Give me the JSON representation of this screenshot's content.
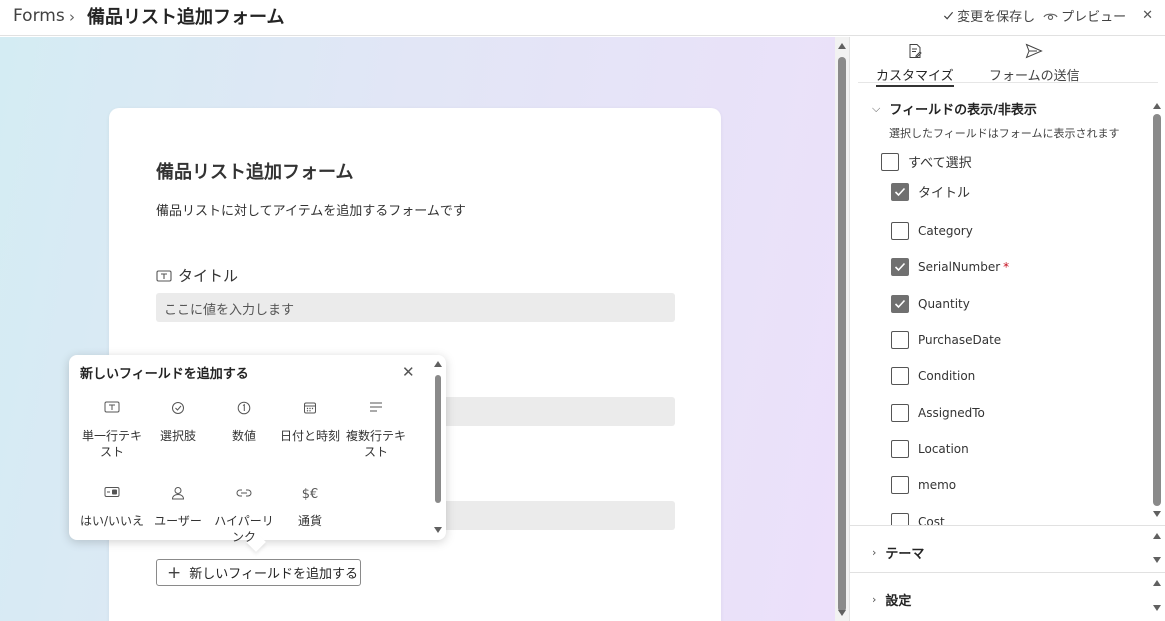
{
  "header": {
    "app_name": "Forms",
    "separator": "›",
    "form_title": "備品リスト追加フォーム",
    "save_label": "変更を保存し",
    "preview_label": "プレビュー",
    "close_glyph": "✕"
  },
  "form": {
    "title": "備品リスト追加フォーム",
    "description": "備品リストに対してアイテムを追加するフォームです",
    "fields": [
      {
        "label": "タイトル",
        "placeholder": "ここに値を入力します"
      }
    ],
    "add_field_button": "新しいフィールドを追加する"
  },
  "popup": {
    "title": "新しいフィールドを追加する",
    "close_glyph": "✕",
    "field_types": [
      {
        "label": "単一行テキスト",
        "icon": "single-line-text-icon"
      },
      {
        "label": "選択肢",
        "icon": "choice-icon"
      },
      {
        "label": "数値",
        "icon": "number-icon"
      },
      {
        "label": "日付と時刻",
        "icon": "calendar-icon"
      },
      {
        "label": "複数行テキスト",
        "icon": "multi-line-text-icon"
      },
      {
        "label": "はい/いいえ",
        "icon": "yes-no-icon"
      },
      {
        "label": "ユーザー",
        "icon": "person-icon"
      },
      {
        "label": "ハイパーリンク",
        "icon": "link-icon"
      },
      {
        "label": "通貨",
        "icon": "currency-icon"
      }
    ]
  },
  "panel": {
    "tabs": [
      {
        "label": "カスタマイズ",
        "icon": "customize-icon",
        "active": true
      },
      {
        "label": "フォームの送信",
        "icon": "send-icon",
        "active": false
      }
    ],
    "section_fields": {
      "title": "フィールドの表示/非表示",
      "subtitle": "選択したフィールドはフォームに表示されます",
      "select_all": "すべて選択",
      "items": [
        {
          "label": "タイトル",
          "checked": true,
          "required": false
        },
        {
          "label": "Category",
          "checked": false,
          "required": false
        },
        {
          "label": "SerialNumber",
          "checked": true,
          "required": true
        },
        {
          "label": "Quantity",
          "checked": true,
          "required": false
        },
        {
          "label": "PurchaseDate",
          "checked": false,
          "required": false
        },
        {
          "label": "Condition",
          "checked": false,
          "required": false
        },
        {
          "label": "AssignedTo",
          "checked": false,
          "required": false
        },
        {
          "label": "Location",
          "checked": false,
          "required": false
        },
        {
          "label": "memo",
          "checked": false,
          "required": false
        },
        {
          "label": "Cost",
          "checked": false,
          "required": false
        }
      ],
      "required_mark": "*"
    },
    "section_theme": {
      "title": "テーマ"
    },
    "section_settings": {
      "title": "設定"
    }
  }
}
